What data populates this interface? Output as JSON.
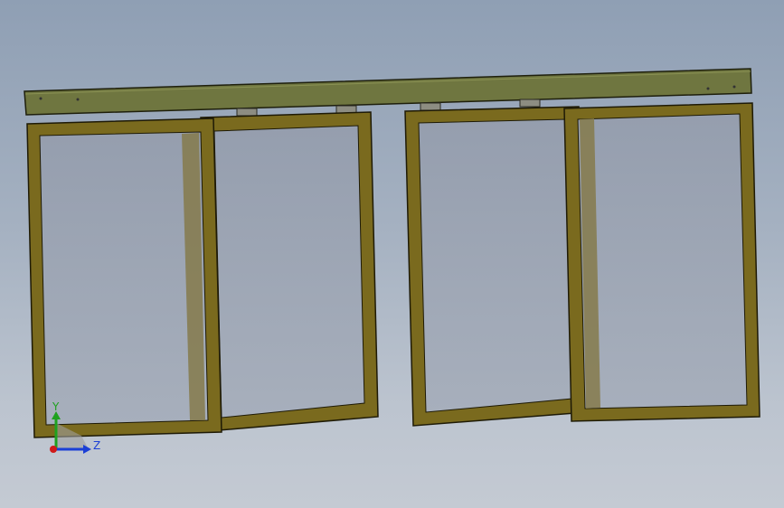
{
  "scene": {
    "frame_color": "#7a6a1e",
    "frame_outline": "#1e1a06",
    "rail_color": "#6f7640",
    "glass_color": "#9ba4b2",
    "background_top": "#8f9fb4",
    "background_bottom": "#c4cad3"
  },
  "triad": {
    "y_label": "Y",
    "z_label": "Z",
    "y_color": "#1fa11f",
    "z_color": "#1b3fd6",
    "x_color": "#d01a1a"
  }
}
